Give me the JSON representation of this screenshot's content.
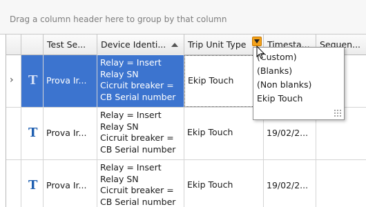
{
  "group_panel": {
    "text": "Drag a column header here to group by that column"
  },
  "columns": {
    "test_session": "Test Se...",
    "device_identifier": "Device Identi...",
    "trip_unit_type": "Trip Unit Type",
    "timestamp": "Timesta...",
    "sequence": "Sequen..."
  },
  "rows": [
    {
      "indicator": "›",
      "icon": "T",
      "test_session": "Prova Ir...",
      "device_lines": [
        "Relay = Insert",
        "Relay SN",
        "Cicruit breaker =",
        "CB Serial number"
      ],
      "trip_unit_type": "Ekip Touch",
      "timestamp": ""
    },
    {
      "indicator": "",
      "icon": "T",
      "test_session": "Prova Ir...",
      "device_lines": [
        "Relay = Insert",
        "Relay SN",
        "Cicruit breaker =",
        "CB Serial number"
      ],
      "trip_unit_type": "Ekip Touch",
      "timestamp": "19/02/2..."
    },
    {
      "indicator": "",
      "icon": "T",
      "test_session": "Prova Ir...",
      "device_lines": [
        "Relay = Insert",
        "Relay SN",
        "Cicruit breaker =",
        "CB Serial number"
      ],
      "trip_unit_type": "Ekip Touch",
      "timestamp": "19/02/2..."
    }
  ],
  "filter_popup": {
    "items": [
      "(Custom)",
      "(Blanks)",
      "(Non blanks)",
      "Ekip Touch"
    ]
  },
  "colors": {
    "selection": "#3c74cf",
    "filter_icon": "#f3a21b",
    "row_icon": "#1f5fb0"
  }
}
